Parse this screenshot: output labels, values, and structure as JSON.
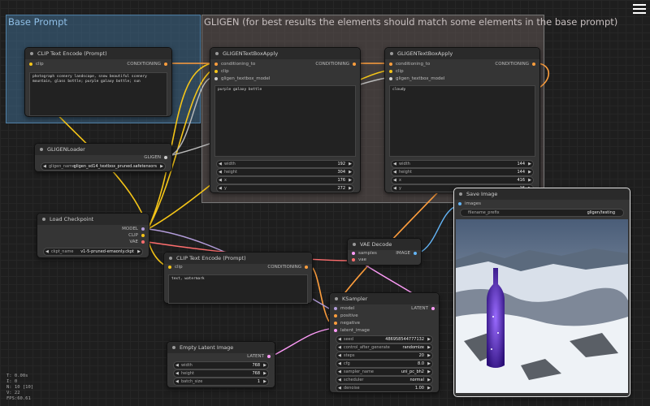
{
  "groups": {
    "base_prompt": "Base Prompt",
    "gligen": "GLIGEN (for best results the elements should match some elements in the base prompt)"
  },
  "clip_top": {
    "title": "CLIP Text Encode (Prompt)",
    "in_clip": "clip",
    "out": "CONDITIONING",
    "text": "photograph scenery landscape, snow beautiful scenery mountain, glass bottle; purple galaxy bottle; sun"
  },
  "gligen_box1": {
    "title": "GLIGENTextBoxApply",
    "in1": "conditioning_to",
    "in2": "clip",
    "in3": "gligen_textbox_model",
    "out": "CONDITIONING",
    "text": "purple galaxy bottle",
    "w": [
      {
        "label": "width",
        "value": "192"
      },
      {
        "label": "height",
        "value": "304"
      },
      {
        "label": "x",
        "value": "176"
      },
      {
        "label": "y",
        "value": "272"
      }
    ]
  },
  "gligen_box2": {
    "title": "GLIGENTextBoxApply",
    "in1": "conditioning_to",
    "in2": "clip",
    "in3": "gligen_textbox_model",
    "out": "CONDITIONING",
    "text": "cloudy",
    "w": [
      {
        "label": "width",
        "value": "144"
      },
      {
        "label": "height",
        "value": "144"
      },
      {
        "label": "x",
        "value": "416"
      },
      {
        "label": "y",
        "value": "16"
      }
    ]
  },
  "gligen_loader": {
    "title": "GLIGENLoader",
    "out": "GLIGEN",
    "w_label": "gligen_name",
    "w_value": "gligen_sd14_textbox_pruned.safetensors"
  },
  "load_ckpt": {
    "title": "Load Checkpoint",
    "out1": "MODEL",
    "out2": "CLIP",
    "out3": "VAE",
    "w_label": "ckpt_name",
    "w_value": "v1-5-pruned-emaonly.ckpt"
  },
  "clip_neg": {
    "title": "CLIP Text Encode (Prompt)",
    "in_clip": "clip",
    "out": "CONDITIONING",
    "text": "text, watermark"
  },
  "vae_decode": {
    "title": "VAE Decode",
    "in1": "samples",
    "in2": "vae",
    "out": "IMAGE"
  },
  "save_image": {
    "title": "Save Image",
    "in1": "images",
    "w_label": "filename_prefix",
    "w_value": "gligen/testing"
  },
  "ksampler": {
    "title": "KSampler",
    "in1": "model",
    "in2": "positive",
    "in3": "negative",
    "in4": "latent_image",
    "out": "LATENT",
    "w": [
      {
        "label": "seed",
        "value": "486958544777132"
      },
      {
        "label": "control_after_generate",
        "value": "randomize"
      },
      {
        "label": "steps",
        "value": "20"
      },
      {
        "label": "cfg",
        "value": "8.0"
      },
      {
        "label": "sampler_name",
        "value": "uni_pc_bh2"
      },
      {
        "label": "scheduler",
        "value": "normal"
      },
      {
        "label": "denoise",
        "value": "1.00"
      }
    ]
  },
  "empty_latent": {
    "title": "Empty Latent Image",
    "out": "LATENT",
    "w": [
      {
        "label": "width",
        "value": "768"
      },
      {
        "label": "height",
        "value": "768"
      },
      {
        "label": "batch_size",
        "value": "1"
      }
    ]
  },
  "stats": [
    "T: 0.00s",
    "I: 0",
    "N: 10 [10]",
    "V: 22",
    "FPS:60.61"
  ],
  "colors": {
    "clip": "#f5c518",
    "conditioning": "#ff9e3d",
    "model": "#b39ddb",
    "vae": "#ff6e6e",
    "latent": "#ff9cf9",
    "image": "#64b5f6",
    "gligen": "#cccccc"
  },
  "icons": {
    "menu": "hamburger-menu-icon"
  }
}
